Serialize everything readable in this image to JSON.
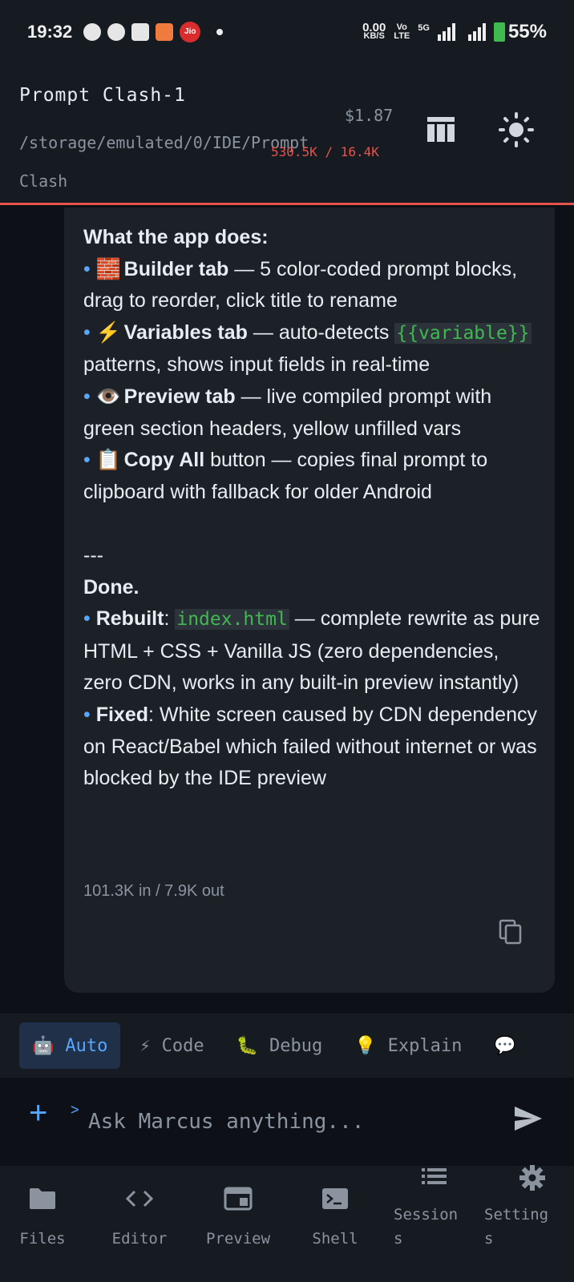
{
  "status": {
    "time": "19:32",
    "net_speed": "0.00",
    "net_unit": "KB/S",
    "volte": "Vo",
    "lte": "LTE",
    "gen": "5G",
    "battery": "55%",
    "jio": "Jio"
  },
  "header": {
    "title": "Prompt Clash-1",
    "path": "/storage/emulated/0/IDE/Prompt Clash",
    "cost": "$1.87",
    "tokens": "530.5K / 16.4K"
  },
  "message": {
    "heading": "What the app does:",
    "b1_icon": "🧱",
    "b1_bold": "Builder tab",
    "b1_text": " — 5 color-coded prompt blocks, drag to reorder, click title to rename",
    "b2_icon": "⚡",
    "b2_bold": "Variables tab",
    "b2_text1": " — auto-detects ",
    "b2_code": "{{variable}}",
    "b2_text2": " patterns, shows input fields in real-time",
    "b3_icon": "👁️",
    "b3_bold": "Preview tab",
    "b3_text": " — live compiled prompt with green section headers, yellow unfilled vars",
    "b4_icon": "📋",
    "b4_bold": "Copy All",
    "b4_text": " button — copies final prompt to clipboard with fallback for older Android",
    "separator": "---",
    "done": "Done.",
    "r_bold": "Rebuilt",
    "r_colon": ": ",
    "r_code": "index.html",
    "r_text": " — complete rewrite as pure HTML + CSS + Vanilla JS (zero dependencies, zero CDN, works in any built-in preview instantly)",
    "f_bold": "Fixed",
    "f_text": ": White screen caused by CDN dependency on React/Babel which failed without internet or was blocked by the IDE preview",
    "usage": "101.3K in / 7.9K out"
  },
  "modes": [
    {
      "icon": "🤖",
      "label": "Auto"
    },
    {
      "icon": "⚡",
      "label": "Code"
    },
    {
      "icon": "🐛",
      "label": "Debug"
    },
    {
      "icon": "💡",
      "label": "Explain"
    },
    {
      "icon": "💬",
      "label": ""
    }
  ],
  "input": {
    "placeholder": "Ask Marcus anything..."
  },
  "nav": [
    {
      "label": "Files"
    },
    {
      "label": "Editor"
    },
    {
      "label": "Preview"
    },
    {
      "label": "Shell"
    },
    {
      "label": "Session s"
    },
    {
      "label": "Setting s"
    }
  ],
  "colors": {
    "accent": "#58a6ff",
    "code_green": "#3fb950",
    "header_border": "#e5534b"
  }
}
